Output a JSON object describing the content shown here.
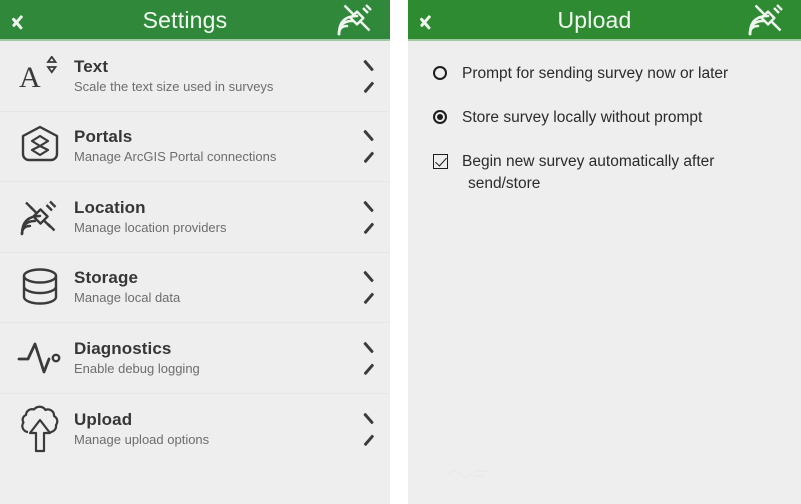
{
  "app": {
    "accent_green": "#2e8b32",
    "screen_bg": "#eeeeee",
    "title_color": "#f2faf2"
  },
  "settings_screen": {
    "appbar": {
      "back_icon": "chevron-left-icon",
      "title": "Settings",
      "action_icon": "satellite-icon"
    },
    "items": [
      {
        "icon": "text-size-icon",
        "title": "Text",
        "subtitle": "Scale the text size used in surveys",
        "chevron": "chevron-right-icon"
      },
      {
        "icon": "portal-shield-icon",
        "title": "Portals",
        "subtitle": "Manage ArcGIS Portal connections",
        "chevron": "chevron-right-icon"
      },
      {
        "icon": "satellite-icon",
        "title": "Location",
        "subtitle": "Manage location providers",
        "chevron": "chevron-right-icon"
      },
      {
        "icon": "database-icon",
        "title": "Storage",
        "subtitle": "Manage local data",
        "chevron": "chevron-right-icon"
      },
      {
        "icon": "pulse-icon",
        "title": "Diagnostics",
        "subtitle": "Enable debug logging",
        "chevron": "chevron-right-icon"
      },
      {
        "icon": "cloud-upload-icon",
        "title": "Upload",
        "subtitle": "Manage upload options",
        "chevron": "chevron-right-icon"
      }
    ]
  },
  "upload_screen": {
    "appbar": {
      "back_icon": "chevron-left-icon",
      "title": "Upload",
      "action_icon": "satellite-icon"
    },
    "options": [
      {
        "control": "radio",
        "checked": false,
        "label": "Prompt for sending survey now or later",
        "label_line2": ""
      },
      {
        "control": "radio",
        "checked": true,
        "label": "Store survey locally without prompt",
        "label_line2": ""
      },
      {
        "control": "checkbox",
        "checked": true,
        "label": "Begin new survey automatically after",
        "label_line2": "send/store"
      }
    ]
  }
}
